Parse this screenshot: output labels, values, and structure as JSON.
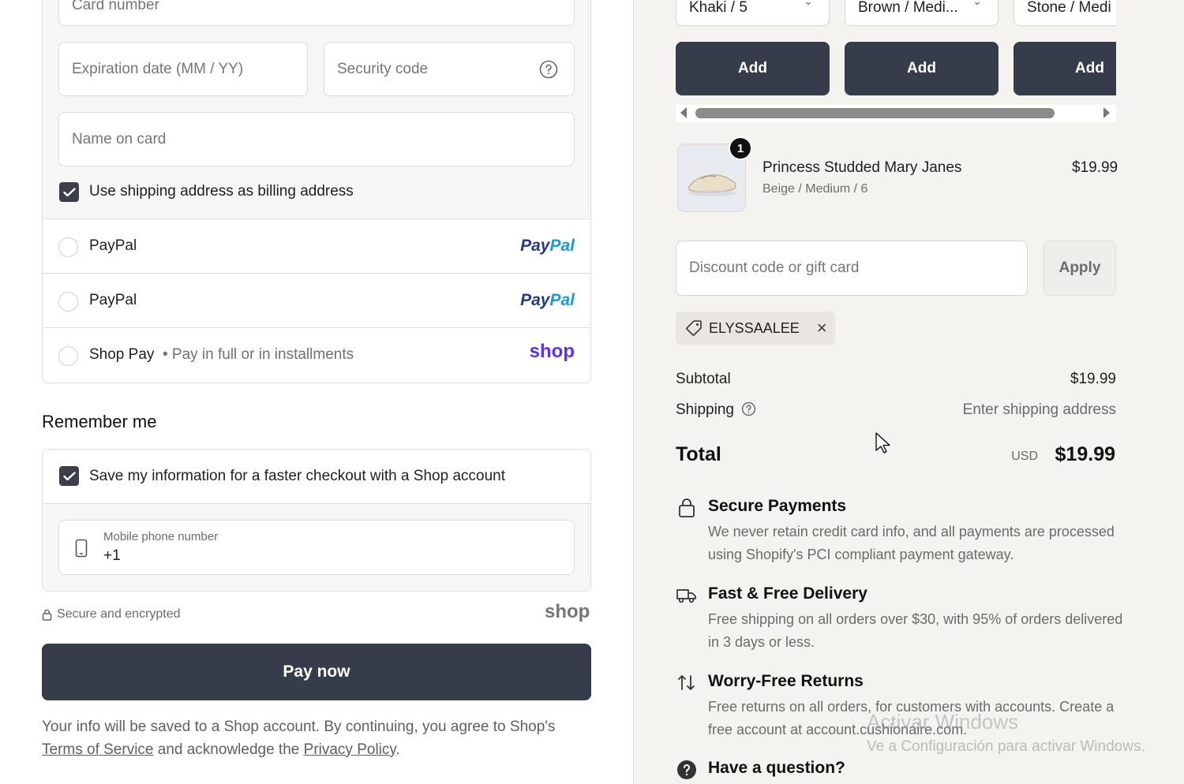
{
  "payment": {
    "card_number_placeholder": "Card number",
    "expiration_placeholder": "Expiration date (MM / YY)",
    "security_code_placeholder": "Security code",
    "name_on_card_placeholder": "Name on card",
    "billing_same_label": "Use shipping address as billing address",
    "methods": [
      {
        "label": "PayPal",
        "logo_text_1": "Pay",
        "logo_text_2": "Pal"
      },
      {
        "label": "PayPal",
        "logo_text_1": "Pay",
        "logo_text_2": "Pal"
      },
      {
        "label": "Shop Pay",
        "sub": "Pay in full or in installments",
        "logo_text": "shop"
      }
    ]
  },
  "remember": {
    "title": "Remember me",
    "save_label": "Save my information for a faster checkout with a Shop account",
    "phone_label": "Mobile phone number",
    "phone_value": "+1"
  },
  "footer": {
    "secure_text": "Secure and encrypted",
    "shop_logo": "shop",
    "pay_button": "Pay now",
    "legal_before": "Your info will be saved to a Shop account. By continuing, you agree to Shop's",
    "terms_link": "Terms of Service",
    "legal_middle": "and acknowledge the",
    "privacy_link": "Privacy Policy",
    "legal_end": "."
  },
  "upsell": {
    "variants": [
      "Khaki / 5",
      "Brown / Medi...",
      "Stone / Medi"
    ],
    "add_label": "Add"
  },
  "cart": {
    "quantity": "1",
    "product_name": "Princess Studded Mary Janes",
    "product_variant": "Beige / Medium / 6",
    "product_price": "$19.99"
  },
  "discount": {
    "placeholder": "Discount code or gift card",
    "apply_label": "Apply",
    "applied_code": "ELYSSAALEE"
  },
  "summary": {
    "subtotal_label": "Subtotal",
    "subtotal_value": "$19.99",
    "shipping_label": "Shipping",
    "shipping_value": "Enter shipping address",
    "total_label": "Total",
    "currency": "USD",
    "total_value": "$19.99"
  },
  "features": [
    {
      "icon": "lock-icon",
      "title": "Secure Payments",
      "text": "We never retain credit card info, and all payments are processed using Shopify's PCI compliant payment gateway."
    },
    {
      "icon": "truck-icon",
      "title": "Fast & Free Delivery",
      "text": "Free shipping on all orders over $30, with 95% of orders delivered in 3 days or less."
    },
    {
      "icon": "returns-arrows-icon",
      "title": "Worry-Free Returns",
      "text": "Free returns on all orders, for customers with accounts. Create a free account at account.cushionaire.com."
    },
    {
      "icon": "question-circle-icon",
      "title": "Have a question?",
      "text": ""
    }
  ],
  "overlay": {
    "watermark_title": "Activar Windows",
    "watermark_sub": "Ve a Configuración para activar Windows."
  },
  "colors": {
    "primary_button": "#363c4a",
    "paypal_dark": "#253b80",
    "paypal_light": "#179bd7",
    "shop_purple": "#5a31f4",
    "summary_bg": "#f5f3ef"
  }
}
